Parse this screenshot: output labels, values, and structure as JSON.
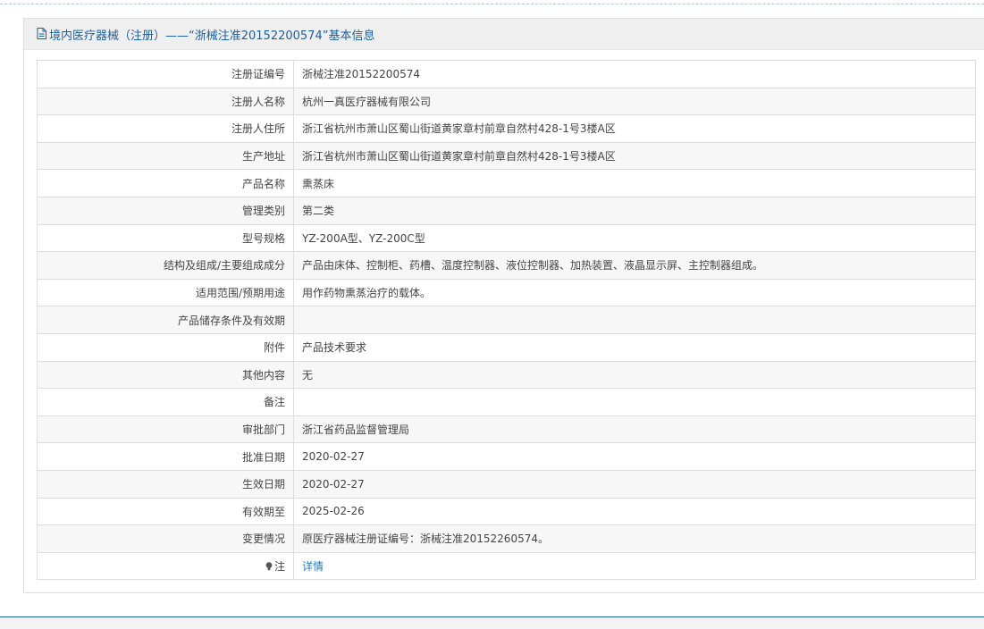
{
  "header": {
    "title": "境内医疗器械（注册）——“浙械注准20152200574”基本信息"
  },
  "rows": [
    {
      "label": "注册证编号",
      "value": "浙械注准20152200574"
    },
    {
      "label": "注册人名称",
      "value": "杭州一真医疗器械有限公司"
    },
    {
      "label": "注册人住所",
      "value": "浙江省杭州市萧山区蜀山街道黄家章村前章自然村428-1号3楼A区"
    },
    {
      "label": "生产地址",
      "value": "浙江省杭州市萧山区蜀山街道黄家章村前章自然村428-1号3楼A区"
    },
    {
      "label": "产品名称",
      "value": "熏蒸床"
    },
    {
      "label": "管理类别",
      "value": "第二类"
    },
    {
      "label": "型号规格",
      "value": "YZ-200A型、YZ-200C型"
    },
    {
      "label": "结构及组成/主要组成成分",
      "value": "产品由床体、控制柜、药槽、温度控制器、液位控制器、加热装置、液晶显示屏、主控制器组成。"
    },
    {
      "label": "适用范围/预期用途",
      "value": "用作药物熏蒸治疗的载体。"
    },
    {
      "label": "产品储存条件及有效期",
      "value": ""
    },
    {
      "label": "附件",
      "value": "产品技术要求"
    },
    {
      "label": "其他内容",
      "value": "无"
    },
    {
      "label": "备注",
      "value": ""
    },
    {
      "label": "审批部门",
      "value": "浙江省药品监督管理局"
    },
    {
      "label": "批准日期",
      "value": "2020-02-27"
    },
    {
      "label": "生效日期",
      "value": "2020-02-27"
    },
    {
      "label": "有效期至",
      "value": "2025-02-26"
    },
    {
      "label": "变更情况",
      "value": "原医疗器械注册证编号：浙械注准20152260574。"
    }
  ],
  "note_row": {
    "label": "注",
    "link_text": "详情",
    "icon": "bulb-icon"
  },
  "colors": {
    "title": "#1c5e9e",
    "link": "#2a7bc2",
    "border": "#dddddd",
    "header_bg": "#efefef",
    "stripe_bg": "#f7f7f7"
  }
}
